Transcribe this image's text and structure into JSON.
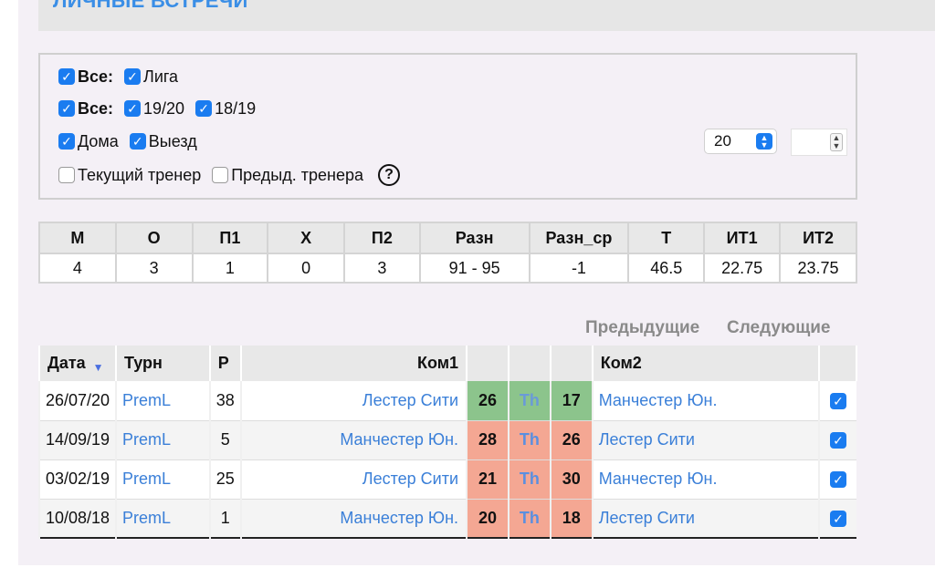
{
  "header": {
    "title": "ЛИЧНЫЕ ВСТРЕЧИ"
  },
  "filters": {
    "row1": {
      "all_label": "Все:",
      "items": [
        {
          "label": "Лига",
          "checked": true
        }
      ]
    },
    "row2": {
      "all_label": "Все:",
      "items": [
        {
          "label": "19/20",
          "checked": true
        },
        {
          "label": "18/19",
          "checked": true
        }
      ]
    },
    "row3": {
      "items": [
        {
          "label": "Дома",
          "checked": true
        },
        {
          "label": "Выезд",
          "checked": true
        }
      ]
    },
    "row4": {
      "items": [
        {
          "label": "Текущий тренер",
          "checked": false
        },
        {
          "label": "Предыд. тренера",
          "checked": false
        }
      ],
      "help": "?"
    },
    "count_select": {
      "value": "20"
    },
    "number_input": {
      "value": ""
    }
  },
  "stats": {
    "headers": [
      "М",
      "О",
      "П1",
      "Х",
      "П2",
      "Разн",
      "Разн_ср",
      "Т",
      "ИТ1",
      "ИТ2"
    ],
    "values": [
      "4",
      "3",
      "1",
      "0",
      "3",
      "91 - 95",
      "-1",
      "46.5",
      "22.75",
      "23.75"
    ]
  },
  "pager": {
    "prev": "Предыдущие",
    "next": "Следующие"
  },
  "matches": {
    "headers": {
      "date": "Дата",
      "tour": "Турн",
      "round": "Р",
      "team1": "Ком1",
      "team2": "Ком2"
    },
    "rows": [
      {
        "date": "26/07/20",
        "tour": "PremL",
        "round": "38",
        "team1": "Лестер Сити",
        "s1": "26",
        "mark": "Th",
        "s2": "17",
        "team2": "Манчестер Юн.",
        "result": "green"
      },
      {
        "date": "14/09/19",
        "tour": "PremL",
        "round": "5",
        "team1": "Манчестер Юн.",
        "s1": "28",
        "mark": "Th",
        "s2": "26",
        "team2": "Лестер Сити",
        "result": "red"
      },
      {
        "date": "03/02/19",
        "tour": "PremL",
        "round": "25",
        "team1": "Лестер Сити",
        "s1": "21",
        "mark": "Th",
        "s2": "30",
        "team2": "Манчестер Юн.",
        "result": "red"
      },
      {
        "date": "10/08/18",
        "tour": "PremL",
        "round": "1",
        "team1": "Манчестер Юн.",
        "s1": "20",
        "mark": "Th",
        "s2": "18",
        "team2": "Лестер Сити",
        "result": "red"
      }
    ]
  },
  "colors": {
    "accent": "#1a7cf0",
    "link": "#3a7fd8",
    "win": "#8cc48c",
    "loss": "#f4a793"
  }
}
